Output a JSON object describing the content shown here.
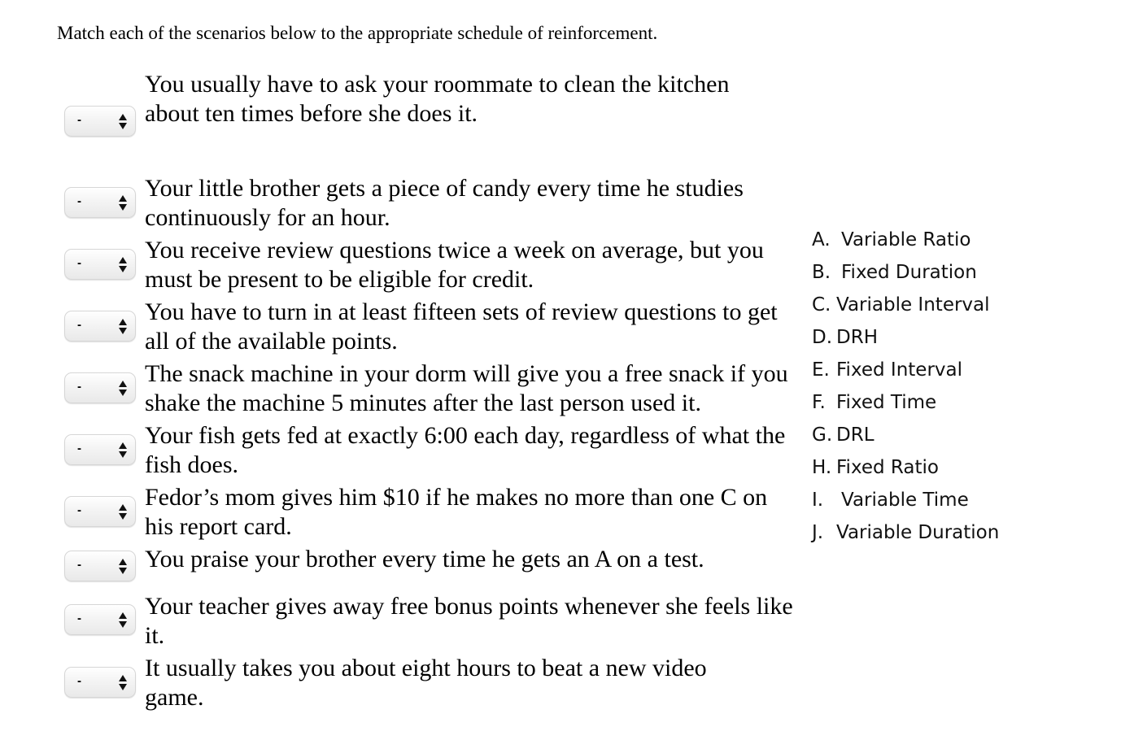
{
  "instructions": "Match each of the scenarios below to the appropriate schedule of reinforcement.",
  "scenarios": [
    {
      "text": "You usually have to ask your roommate to clean the kitchen about ten times before she does it.",
      "selected": "-"
    },
    {
      "text": "Your little brother gets a piece of candy every time he studies continuously for an hour.",
      "selected": "-"
    },
    {
      "text": "You receive review questions twice a week on average, but you must be present to be eligible for credit.",
      "selected": "-"
    },
    {
      "text": "You have to turn in at least fifteen sets of review questions to get all of the available points.",
      "selected": "-"
    },
    {
      "text": "The snack machine in your dorm will give you a free snack if you shake the machine 5 minutes after the last person used it.",
      "selected": "-"
    },
    {
      "text": "Your fish gets fed at exactly 6:00 each day, regardless of what the fish does.",
      "selected": "-"
    },
    {
      "text": "Fedor’s mom gives him $10 if he makes no more than one C on his report card.",
      "selected": "-"
    },
    {
      "text": "You praise your brother every time he gets an A on a test.",
      "selected": "-"
    },
    {
      "text": "Your teacher gives away free bonus points whenever she feels like it.",
      "selected": "-"
    },
    {
      "text": "It usually takes you about eight hours to beat a new video game.",
      "selected": "-"
    }
  ],
  "options": [
    {
      "letter": "A.",
      "label": "Variable Ratio"
    },
    {
      "letter": "B.",
      "label": "Fixed Duration"
    },
    {
      "letter": "C.",
      "label": "Variable Interval"
    },
    {
      "letter": "D.",
      "label": "DRH"
    },
    {
      "letter": "E.",
      "label": "Fixed Interval"
    },
    {
      "letter": "F.",
      "label": "Fixed Time"
    },
    {
      "letter": "G.",
      "label": "DRL"
    },
    {
      "letter": "H.",
      "label": "Fixed Ratio"
    },
    {
      "letter": "I.",
      "label": "Variable Time"
    },
    {
      "letter": "J.",
      "label": "Variable Duration"
    }
  ]
}
